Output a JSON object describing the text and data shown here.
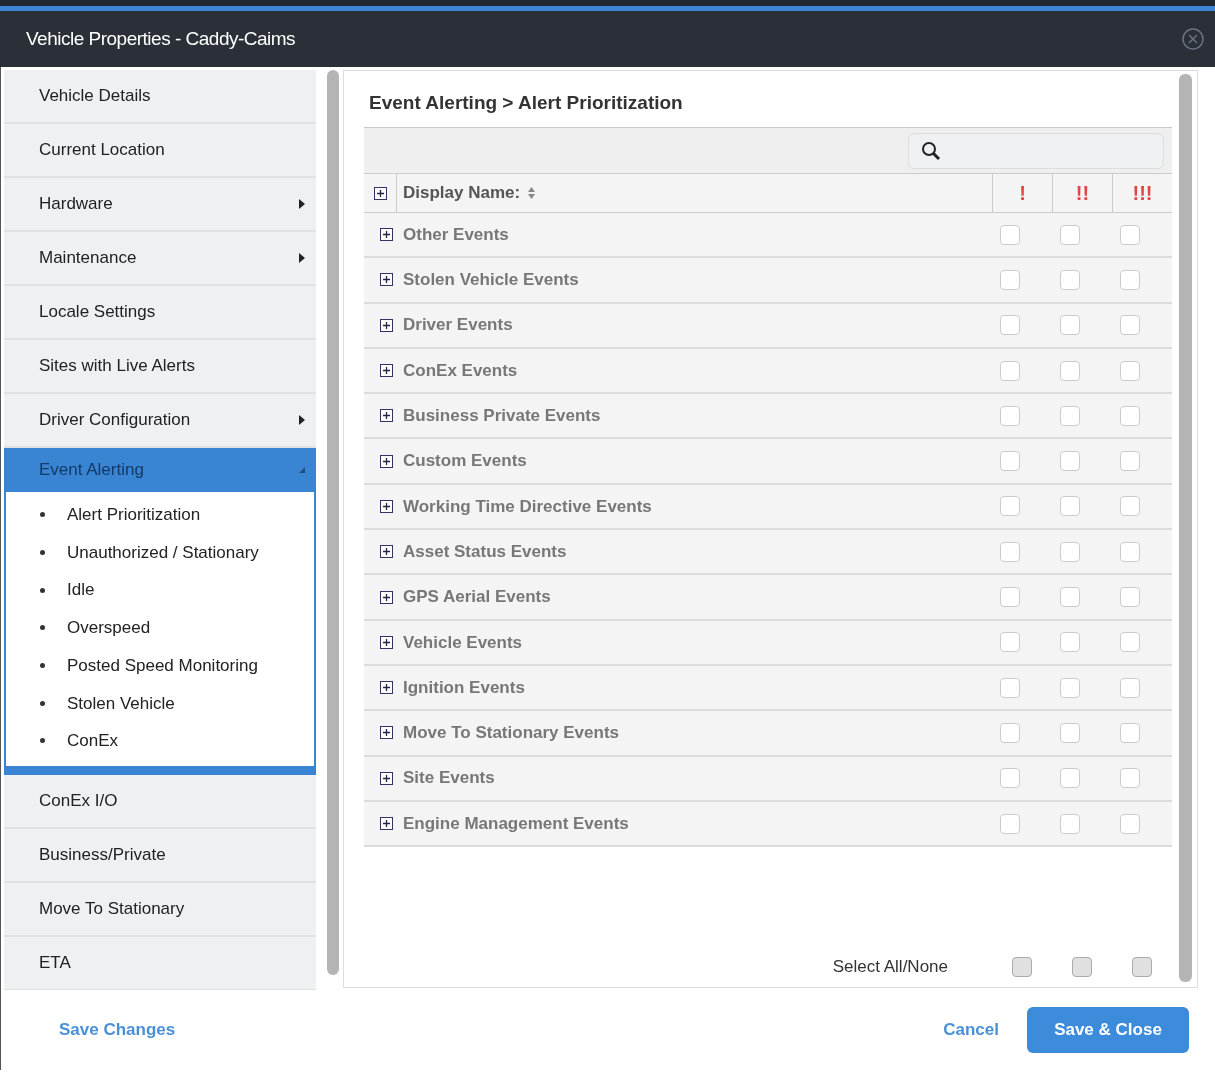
{
  "window": {
    "title": "Vehicle Properties - Caddy-Caims"
  },
  "sidebar": {
    "items": [
      {
        "label": "Vehicle Details",
        "kind": "link",
        "selected": false
      },
      {
        "label": "Current Location",
        "kind": "link",
        "selected": false
      },
      {
        "label": "Hardware",
        "kind": "submenu",
        "selected": false,
        "expanded": false
      },
      {
        "label": "Maintenance",
        "kind": "submenu",
        "selected": false,
        "expanded": false
      },
      {
        "label": "Locale Settings",
        "kind": "link",
        "selected": false
      },
      {
        "label": "Sites with Live Alerts",
        "kind": "link",
        "selected": false
      },
      {
        "label": "Driver Configuration",
        "kind": "submenu",
        "selected": false,
        "expanded": false
      },
      {
        "label": "Event Alerting",
        "kind": "submenu",
        "selected": true,
        "expanded": true,
        "children": [
          {
            "label": "Alert Prioritization"
          },
          {
            "label": "Unauthorized / Stationary"
          },
          {
            "label": "Idle"
          },
          {
            "label": "Overspeed"
          },
          {
            "label": "Posted Speed Monitoring"
          },
          {
            "label": "Stolen Vehicle"
          },
          {
            "label": "ConEx"
          }
        ]
      },
      {
        "label": "ConEx I/O",
        "kind": "link",
        "selected": false
      },
      {
        "label": "Business/Private",
        "kind": "link",
        "selected": false
      },
      {
        "label": "Move To Stationary",
        "kind": "link",
        "selected": false
      },
      {
        "label": "ETA",
        "kind": "link",
        "selected": false
      }
    ]
  },
  "breadcrumb": "Event Alerting > Alert Prioritization",
  "table": {
    "columns": [
      "Display Name:",
      "!",
      "!!",
      "!!!"
    ],
    "rows": [
      {
        "label": "Other Events",
        "checks": [
          false,
          false,
          false
        ]
      },
      {
        "label": "Stolen Vehicle Events",
        "checks": [
          false,
          false,
          false
        ]
      },
      {
        "label": "Driver Events",
        "checks": [
          false,
          false,
          false
        ]
      },
      {
        "label": "ConEx Events",
        "checks": [
          false,
          false,
          false
        ]
      },
      {
        "label": "Business Private Events",
        "checks": [
          false,
          false,
          false
        ]
      },
      {
        "label": "Custom Events",
        "checks": [
          false,
          false,
          false
        ]
      },
      {
        "label": "Working Time Directive Events",
        "checks": [
          false,
          false,
          false
        ]
      },
      {
        "label": "Asset Status Events",
        "checks": [
          false,
          false,
          false
        ]
      },
      {
        "label": "GPS Aerial Events",
        "checks": [
          false,
          false,
          false
        ]
      },
      {
        "label": "Vehicle Events",
        "checks": [
          false,
          false,
          false
        ]
      },
      {
        "label": "Ignition Events",
        "checks": [
          false,
          false,
          false
        ]
      },
      {
        "label": "Move To Stationary Events",
        "checks": [
          false,
          false,
          false
        ]
      },
      {
        "label": "Site Events",
        "checks": [
          false,
          false,
          false
        ]
      },
      {
        "label": "Engine Management Events",
        "checks": [
          false,
          false,
          false
        ]
      }
    ]
  },
  "select_all": {
    "label": "Select All/None",
    "checks": [
      false,
      false,
      false
    ]
  },
  "footer": {
    "save_changes": "Save Changes",
    "cancel": "Cancel",
    "save_close": "Save & Close"
  }
}
